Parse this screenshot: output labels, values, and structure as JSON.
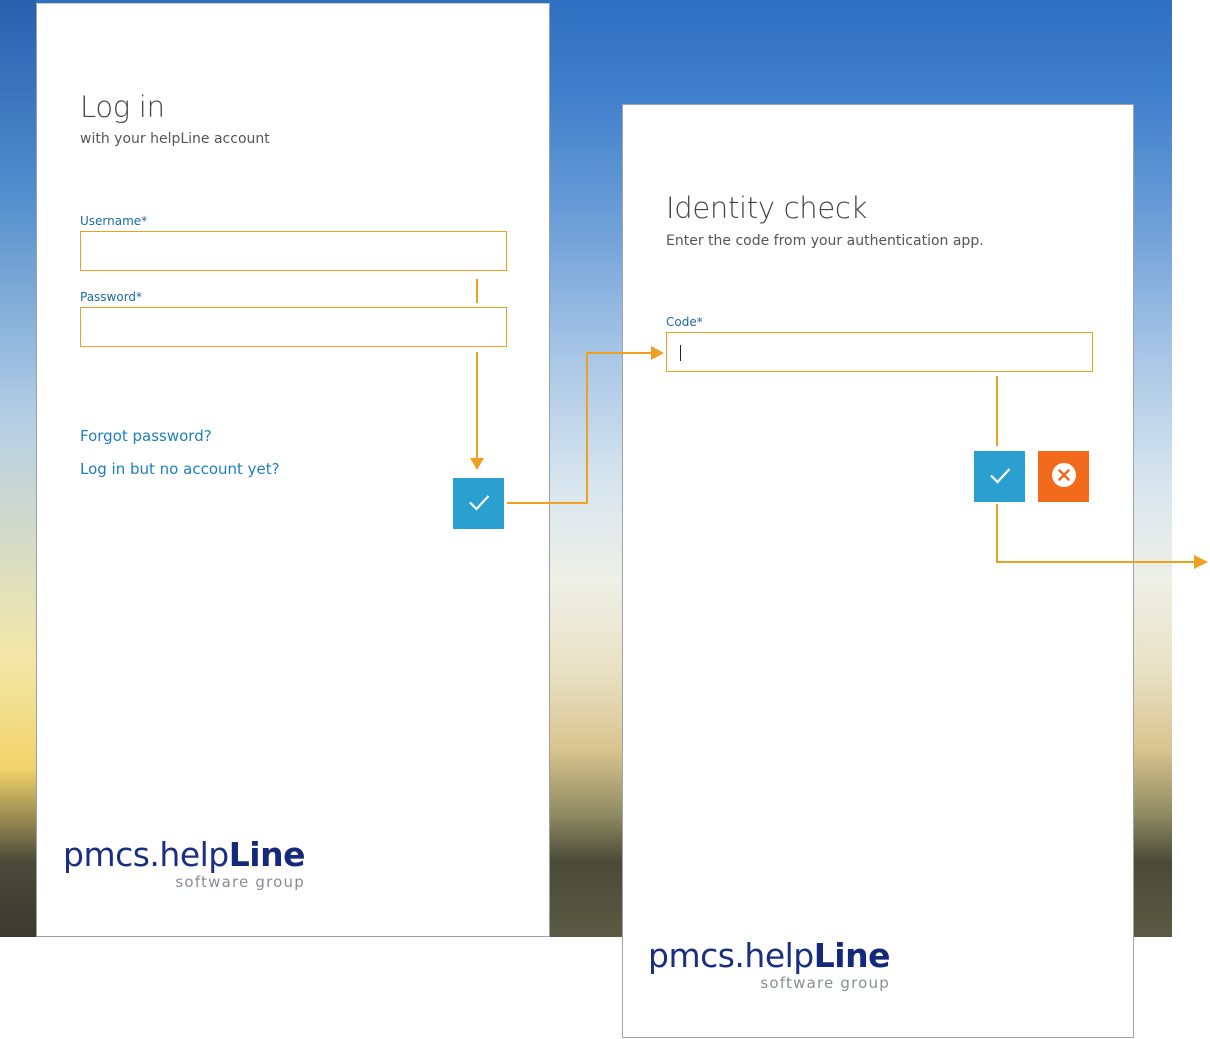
{
  "login": {
    "title": "Log in",
    "subtitle": "with your helpLine account",
    "username_label": "Username*",
    "username_value": "",
    "password_label": "Password*",
    "password_value": "",
    "forgot_password_link": "Forgot password?",
    "no_account_link": "Log in but no account yet?",
    "submit_icon": "checkmark-icon"
  },
  "identity": {
    "title": "Identity check",
    "subtitle": "Enter the code from your authentication app.",
    "code_label": "Code*",
    "code_value": "",
    "confirm_icon": "checkmark-icon",
    "cancel_icon": "close-circle-icon"
  },
  "brand": {
    "logo_text_regular": "pmcs.help",
    "logo_text_bold": "Line",
    "tagline": "software group"
  },
  "colors": {
    "accent_blue": "#2a9fd0",
    "cancel_orange": "#f26b1d",
    "field_border": "#f0a020",
    "flow_arrow": "#f0a020",
    "link": "#1d7fbf",
    "logo_blue": "#1b2f82"
  }
}
